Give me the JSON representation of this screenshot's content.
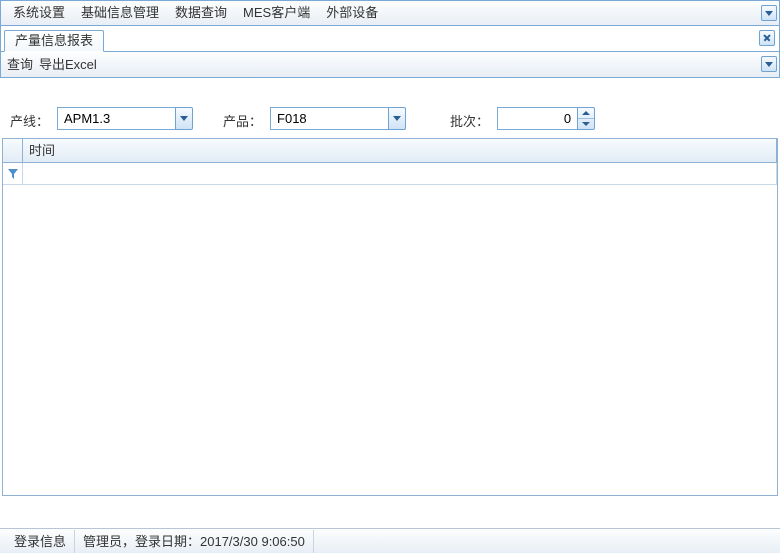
{
  "menu": {
    "items": [
      "系统设置",
      "基础信息管理",
      "数据查询",
      "MES客户端",
      "外部设备"
    ]
  },
  "tab": {
    "title": "产量信息报表"
  },
  "toolbar": {
    "query": "查询",
    "export": "导出Excel"
  },
  "filters": {
    "line_label": "产线：",
    "line_value": "APM1.3",
    "product_label": "产品：",
    "product_value": "F018",
    "batch_label": "批次：",
    "batch_value": "0"
  },
  "grid": {
    "columns": {
      "time": "时间"
    }
  },
  "status": {
    "login_label": "登录信息",
    "login_text": "管理员，登录日期：2017/3/30 9:06:50"
  }
}
